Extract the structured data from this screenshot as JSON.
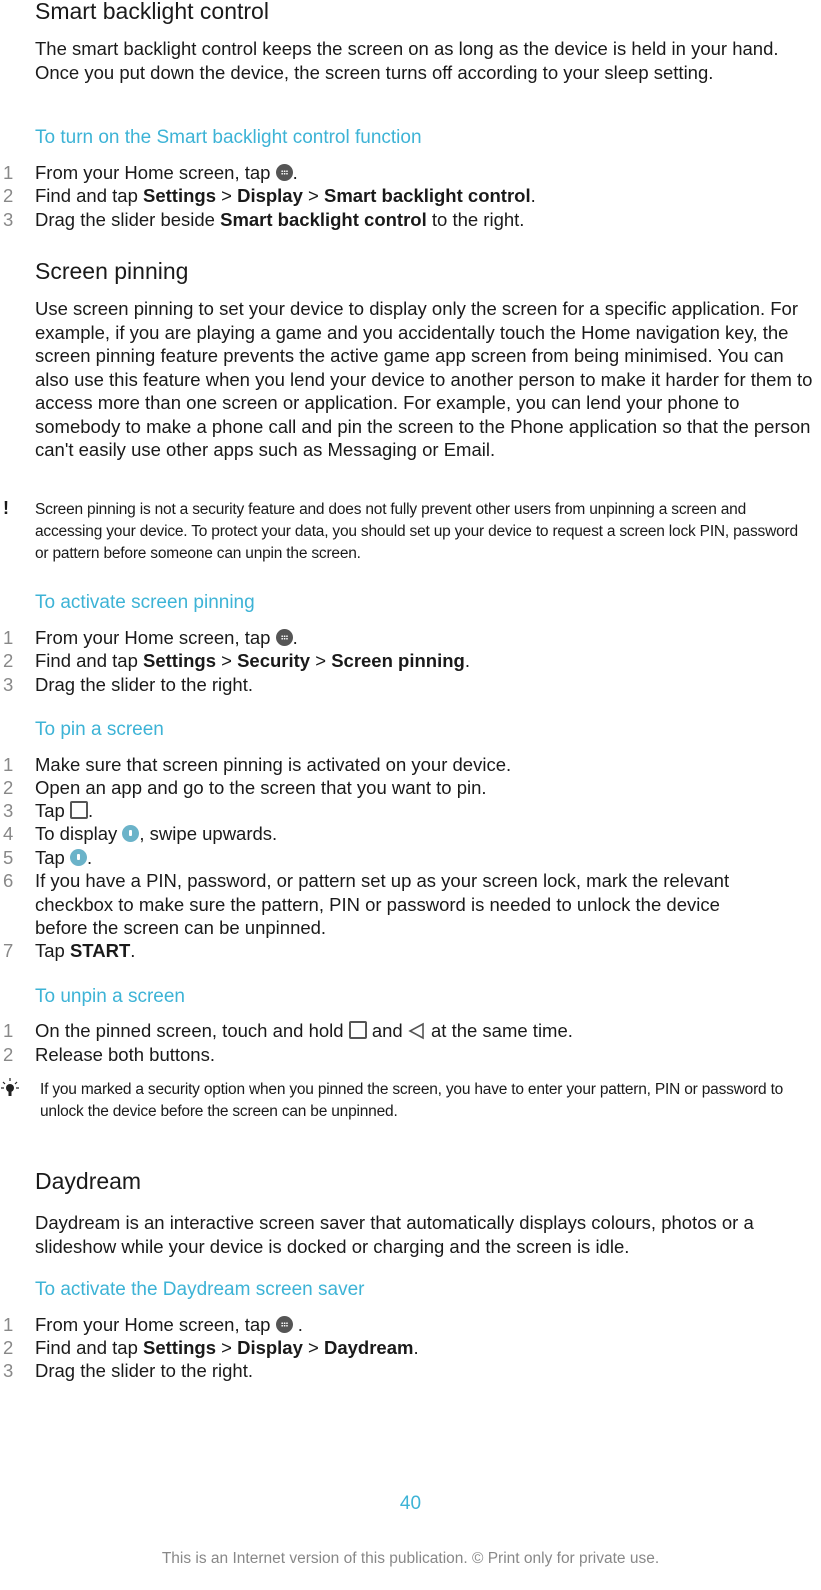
{
  "sections": {
    "smart_backlight": {
      "heading": "Smart backlight control",
      "body": "The smart backlight control keeps the screen on as long as the device is held in your hand. Once you put down the device, the screen turns off according to your sleep setting.",
      "procedure_title": "To turn on the Smart backlight control function",
      "steps": [
        {
          "num": "1",
          "pre": "From your Home screen, tap ",
          "icon": "apps-icon",
          "post": "."
        },
        {
          "num": "2",
          "pre": "Find and tap ",
          "bold1": "Settings",
          "sep1": " > ",
          "bold2": "Display",
          "sep2": " > ",
          "bold3": "Smart backlight control",
          "post": "."
        },
        {
          "num": "3",
          "pre": "Drag the slider beside ",
          "bold1": "Smart backlight control",
          "post": " to the right."
        }
      ]
    },
    "screen_pinning": {
      "heading": "Screen pinning",
      "body": "Use screen pinning to set your device to display only the screen for a specific application. For example, if you are playing a game and you accidentally touch the Home navigation key, the screen pinning feature prevents the active game app screen from being minimised. You can also use this feature when you lend your device to another person to make it harder for them to access more than one screen or application. For example, you can lend your phone to somebody to make a phone call and pin the screen to the Phone application so that the person can't easily use other apps such as Messaging or Email.",
      "warning_icon": "exclamation-icon",
      "warning": "Screen pinning is not a security feature and does not fully prevent other users from unpinning a screen and accessing your device. To protect your data, you should set up your device to request a screen lock PIN, password or pattern before someone can unpin the screen.",
      "activate": {
        "title": "To activate screen pinning",
        "steps": [
          {
            "num": "1",
            "pre": "From your Home screen, tap ",
            "post": "."
          },
          {
            "num": "2",
            "pre": "Find and tap ",
            "bold1": "Settings",
            "sep1": " > ",
            "bold2": "Security",
            "sep2": " > ",
            "bold3": "Screen pinning",
            "post": "."
          },
          {
            "num": "3",
            "text": "Drag the slider to the right."
          }
        ]
      },
      "pin": {
        "title": "To pin a screen",
        "steps": [
          {
            "num": "1",
            "text": "Make sure that screen pinning is activated on your device."
          },
          {
            "num": "2",
            "text": "Open an app and go to the screen that you want to pin."
          },
          {
            "num": "3",
            "pre": "Tap ",
            "post": "."
          },
          {
            "num": "4",
            "pre": "To display ",
            "post": ", swipe upwards."
          },
          {
            "num": "5",
            "pre": "Tap ",
            "post": "."
          },
          {
            "num": "6",
            "text": "If you have a PIN, password, or pattern set up as your screen lock, mark the relevant checkbox to make sure the pattern, PIN or password is needed to unlock the device before the screen can be unpinned."
          },
          {
            "num": "7",
            "pre": "Tap ",
            "bold1": "START",
            "post": "."
          }
        ]
      },
      "unpin": {
        "title": "To unpin a screen",
        "steps": [
          {
            "num": "1",
            "pre": "On the pinned screen, touch and hold ",
            "mid": " and ",
            "post": " at the same time."
          },
          {
            "num": "2",
            "text": "Release both buttons."
          }
        ],
        "tip_icon": "lightbulb-icon",
        "tip": "If you marked a security option when you pinned the screen, you have to enter your pattern, PIN or password to unlock the device before the screen can be unpinned."
      }
    },
    "daydream": {
      "heading": "Daydream",
      "body": "Daydream is an interactive screen saver that automatically displays colours, photos or a slideshow while your device is docked or charging and the screen is idle.",
      "procedure_title": "To activate the Daydream screen saver",
      "steps": [
        {
          "num": "1",
          "pre": "From your Home screen, tap ",
          "post": " ."
        },
        {
          "num": "2",
          "pre": "Find and tap ",
          "bold1": "Settings",
          "sep1": " > ",
          "bold2": "Display",
          "sep2": " > ",
          "bold3": "Daydream",
          "post": "."
        },
        {
          "num": "3",
          "text": "Drag the slider to the right."
        }
      ]
    }
  },
  "footer": {
    "page_number": "40",
    "notice": "This is an Internet version of this publication. © Print only for private use."
  },
  "colors": {
    "accent": "#3db3d6",
    "text": "#1a1a1a",
    "muted": "#888888"
  }
}
